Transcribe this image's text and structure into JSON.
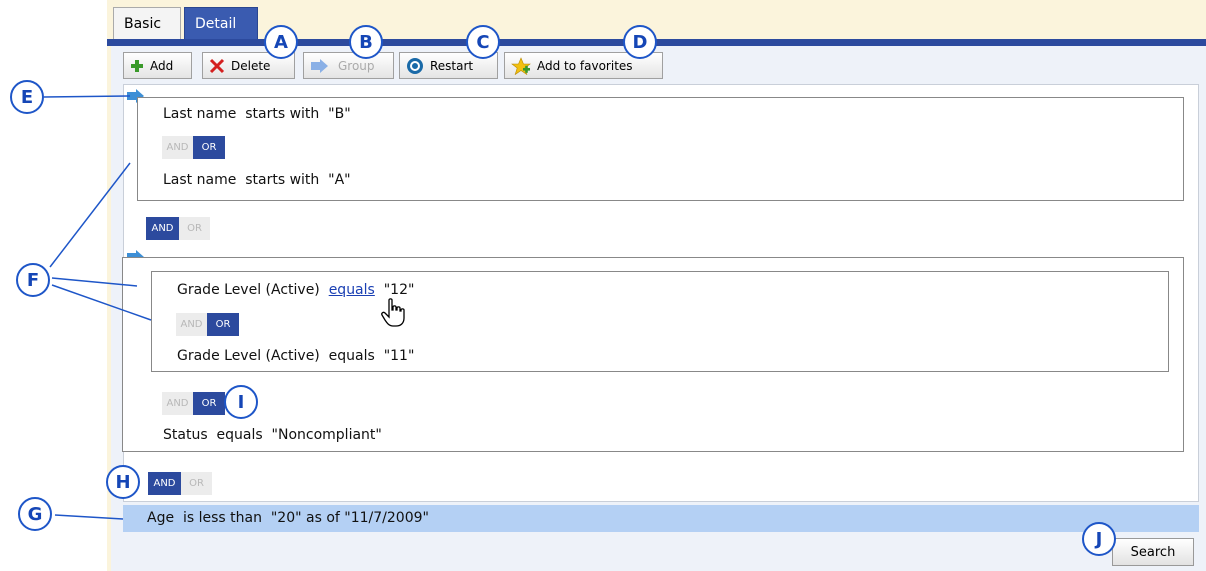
{
  "tabs": [
    {
      "label": "Basic",
      "active": false
    },
    {
      "label": "Detail",
      "active": true
    }
  ],
  "toolbar": {
    "add_label": "Add",
    "delete_label": "Delete",
    "group_label": "Group",
    "restart_label": "Restart",
    "favorites_label": "Add to favorites"
  },
  "group1": {
    "cond1": "Last name  starts with  \"B\"",
    "cond2": "Last name  starts with  \"A\"",
    "connector": {
      "and": "AND",
      "or": "OR",
      "selected": "OR"
    }
  },
  "between_groups": {
    "and": "AND",
    "or": "OR",
    "selected": "AND"
  },
  "group2": {
    "inner": {
      "cond1_field": "Grade Level (Active)",
      "cond1_operator": "equals",
      "cond1_value": "\"12\"",
      "cond2": "Grade Level (Active)  equals  \"11\"",
      "connector": {
        "and": "AND",
        "or": "OR",
        "selected": "OR"
      }
    },
    "connector": {
      "and": "AND",
      "or": "OR",
      "selected": "OR"
    },
    "cond3": "Status  equals  \"Noncompliant\""
  },
  "final_connector": {
    "and": "AND",
    "or": "OR",
    "selected": "AND"
  },
  "final_cond": "Age  is less than  \"20\" as of \"11/7/2009\"",
  "search_label": "Search",
  "callouts": {
    "A": "A",
    "B": "B",
    "C": "C",
    "D": "D",
    "E": "E",
    "F": "F",
    "G": "G",
    "H": "H",
    "I": "I",
    "J": "J"
  },
  "colors": {
    "accent": "#2c4a9e",
    "callout": "#1e56c8",
    "selected_row": "#b4d0f4"
  }
}
